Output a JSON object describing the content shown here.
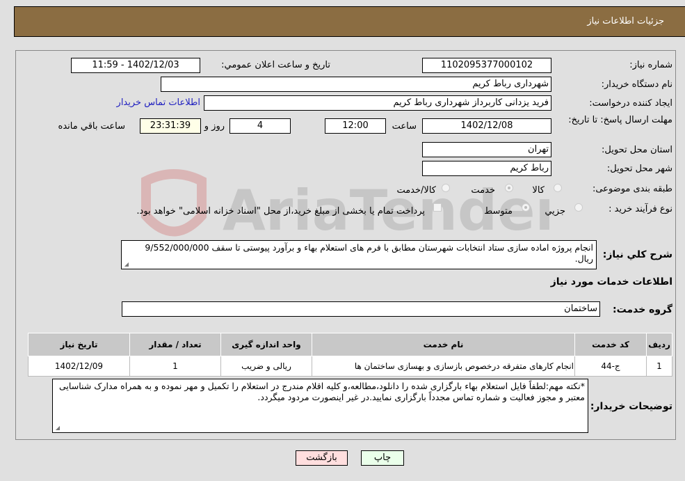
{
  "header": {
    "title": "جزئیات اطلاعات نیاز"
  },
  "form": {
    "need_number_label": "شماره نیاز:",
    "need_number": "1102095377000102",
    "announce_label": "تاریخ و ساعت اعلان عمومي:",
    "announce_value": "1402/12/03 - 11:59",
    "buyer_org_label": "نام دستگاه خريدار:",
    "buyer_org": "شهرداری رباط کریم",
    "requester_label": "ايجاد کننده درخواست:",
    "requester": "فرید یزدانی کاربرداز شهرداری رباط کریم",
    "contact_link": "اطلاعات تماس خريدار",
    "deadline_label": "مهلت ارسال پاسخ: تا تاریخ:",
    "deadline_date": "1402/12/08",
    "time_label": "ساعت",
    "deadline_time": "12:00",
    "days_value": "4",
    "days_label": "روز و",
    "remaining_time": "23:31:39",
    "remaining_label": "ساعت باقي مانده",
    "province_label": "استان محل تحویل:",
    "province": "تهران",
    "city_label": "شهر محل تحویل:",
    "city": "رباط کریم",
    "category_label": "طبقه بندی موضوعی:",
    "category_options": [
      "کالا",
      "خدمت",
      "کالا/خدمت"
    ],
    "category_selected": "خدمت",
    "process_label": "نوع فرآیند خرید :",
    "process_options": [
      "جزيي",
      "متوسط"
    ],
    "process_selected": "متوسط",
    "treasury_note": "پرداخت تمام یا بخشی از مبلغ خرید،از محل \"اسناد خزانه اسلامی\" خواهد بود.",
    "description_label": "شرح کلي نياز:",
    "description": "انجام پروژه اماده سازی ستاد انتخابات شهرستان مطابق با فرم های استعلام بهاء و برآورد پیوستی تا سقف 9/552/000/000 ریال.",
    "services_title": "اطلاعات خدمات مورد نياز",
    "service_group_label": "گروه خدمت:",
    "service_group": "ساختمان"
  },
  "table": {
    "headers": [
      "رديف",
      "کد خدمت",
      "نام خدمت",
      "واحد اندازه گيری",
      "تعداد / مقدار",
      "تاریخ نیاز"
    ],
    "rows": [
      [
        "1",
        "ج-44",
        "انجام کارهای متفرقه درخصوص بازسازی و بهسازی ساختمان ها",
        "ریالی و ضریب",
        "1",
        "1402/12/09"
      ]
    ]
  },
  "buyer_notes_label": "توضيحات خريدار:",
  "buyer_notes": "*نکته مهم:لطفاً فایل استعلام بهاء بارگزاری شده را دانلود،مطالعه،و کلیه اقلام مندرج در استعلام را تکمیل و مهر نموده و به همراه مدارک شناسایی معتبر و مجوز فعالیت و شماره تماس مجدداً بارگزاری نمایید.در غیر اینصورت مردود میگردد.",
  "buttons": {
    "print": "چاپ",
    "back": "بازگشت"
  },
  "watermark": {
    "text": "AriaTender.neT"
  },
  "colors": {
    "header": "#8b6d42",
    "back_button": "#ffdede",
    "print_button": "#eaffea",
    "link": "#2020c0"
  }
}
